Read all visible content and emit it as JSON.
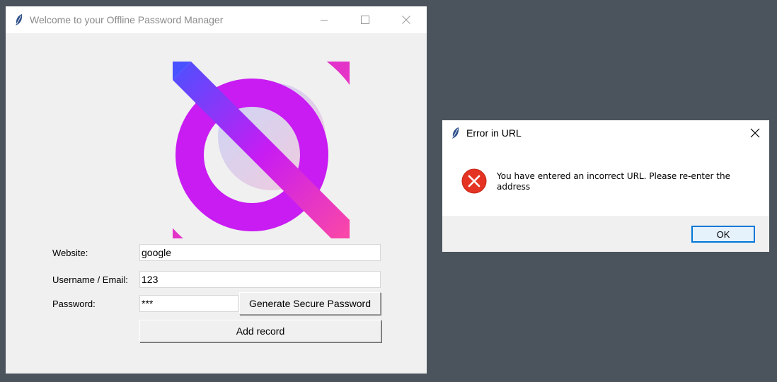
{
  "main_window": {
    "title": "Welcome to your Offline Password Manager",
    "form": {
      "website_label": "Website:",
      "website_value": "google",
      "username_label": "Username / Email:",
      "username_value": "123",
      "password_label": "Password:",
      "password_value": "***",
      "generate_button": "Generate Secure Password",
      "add_button": "Add record"
    }
  },
  "error_dialog": {
    "title": "Error in URL",
    "message": "You have entered an incorrect URL. Please re-enter the address",
    "ok_button": "OK",
    "icon": "error-icon"
  },
  "colors": {
    "desktop": "#4b545c",
    "window_bg": "#f0f0f0",
    "error_red": "#e53323",
    "accent": "#0078d7",
    "logo_blue": "#4a52ff",
    "logo_purple": "#c81cf2",
    "logo_pink": "#ff4c9f"
  }
}
